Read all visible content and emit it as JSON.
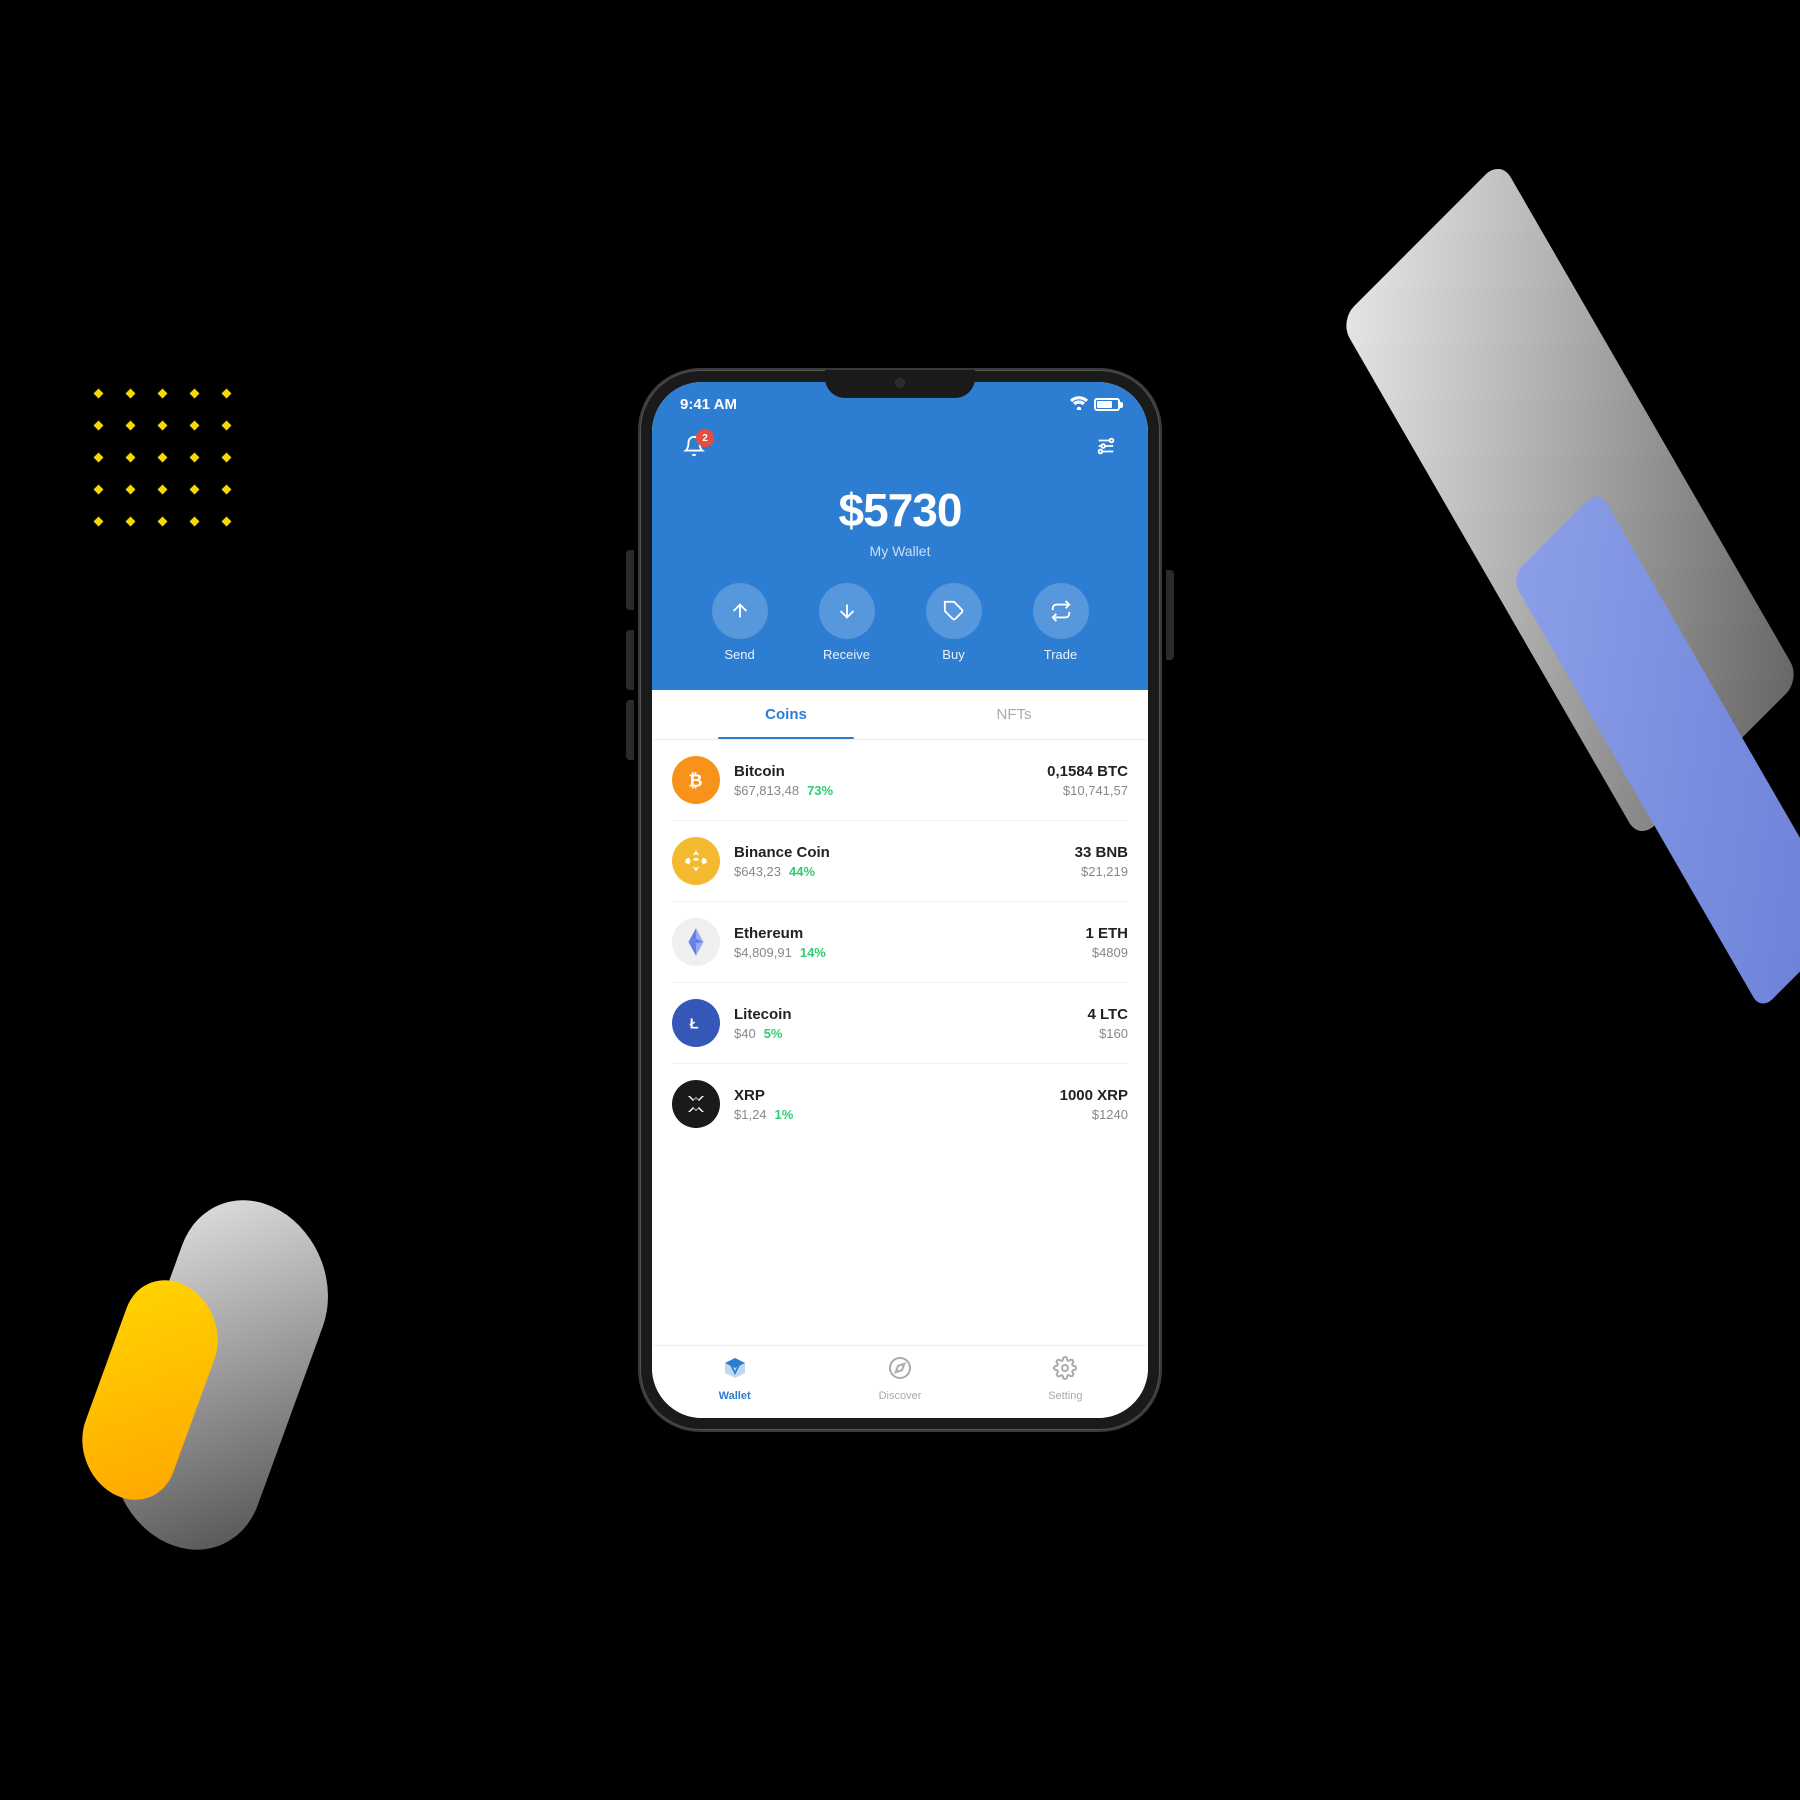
{
  "background": {
    "color": "#000000"
  },
  "statusBar": {
    "time": "9:41 AM",
    "battery_level": 75
  },
  "header": {
    "notification_badge": "2",
    "wallet_amount": "$5730",
    "wallet_label": "My Wallet"
  },
  "actions": [
    {
      "id": "send",
      "label": "Send"
    },
    {
      "id": "receive",
      "label": "Receive"
    },
    {
      "id": "buy",
      "label": "Buy"
    },
    {
      "id": "trade",
      "label": "Trade"
    }
  ],
  "tabs": [
    {
      "id": "coins",
      "label": "Coins",
      "active": true
    },
    {
      "id": "nfts",
      "label": "NFTs",
      "active": false
    }
  ],
  "coins": [
    {
      "id": "btc",
      "name": "Bitcoin",
      "price": "$67,813,48",
      "change": "73%",
      "amount": "0,1584 BTC",
      "value": "$10,741,57",
      "icon_type": "btc"
    },
    {
      "id": "bnb",
      "name": "Binance Coin",
      "price": "$643,23",
      "change": "44%",
      "amount": "33 BNB",
      "value": "$21,219",
      "icon_type": "bnb"
    },
    {
      "id": "eth",
      "name": "Ethereum",
      "price": "$4,809,91",
      "change": "14%",
      "amount": "1 ETH",
      "value": "$4809",
      "icon_type": "eth"
    },
    {
      "id": "ltc",
      "name": "Litecoin",
      "price": "$40",
      "change": "5%",
      "amount": "4 LTC",
      "value": "$160",
      "icon_type": "ltc"
    },
    {
      "id": "xrp",
      "name": "XRP",
      "price": "$1,24",
      "change": "1%",
      "amount": "1000 XRP",
      "value": "$1240",
      "icon_type": "xrp"
    }
  ],
  "bottomNav": [
    {
      "id": "wallet",
      "label": "Wallet",
      "active": true
    },
    {
      "id": "discover",
      "label": "Discover",
      "active": false
    },
    {
      "id": "setting",
      "label": "Setting",
      "active": false
    }
  ]
}
